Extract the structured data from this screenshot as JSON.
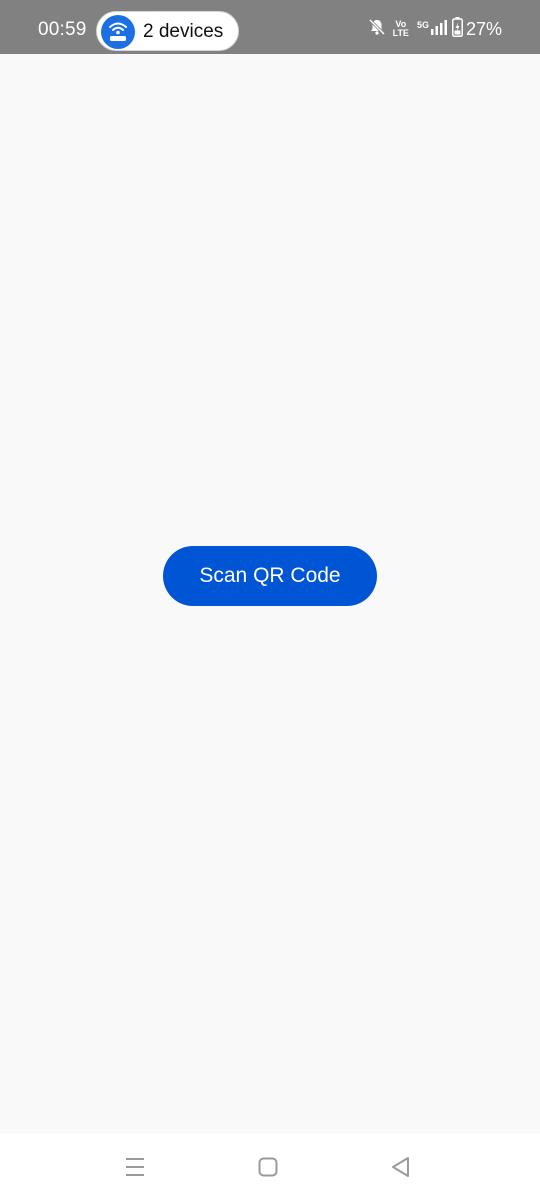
{
  "status_bar": {
    "time": "00:59",
    "hotspot_label": "2 devices",
    "volte_top": "Vo",
    "volte_bottom": "LTE",
    "network": "5G",
    "battery_percent": "27%",
    "icons": [
      "hotspot-icon",
      "bell-muted-icon",
      "volte-icon",
      "signal-icon",
      "battery-charging-icon"
    ]
  },
  "main": {
    "scan_button_label": "Scan QR Code",
    "accent_color": "#0055d4"
  },
  "nav_bar": {
    "icons": [
      "menu-icon",
      "home-icon",
      "back-icon"
    ]
  }
}
